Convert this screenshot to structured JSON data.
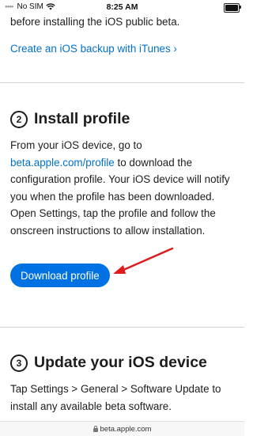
{
  "status_bar": {
    "carrier": "No SIM",
    "time": "8:25 AM"
  },
  "previous_section": {
    "text": "before installing the iOS public beta.",
    "backup_link": "Create an iOS backup with iTunes ›"
  },
  "step2": {
    "number": "2",
    "title": "Install profile",
    "text_before_link": "From your iOS device, go to ",
    "link": "beta.apple.com/profile",
    "text_after_link": " to download the configuration profile. Your iOS device will notify you when the profile has been downloaded. Open Settings, tap the profile and follow the onscreen instructions to allow installation.",
    "button_label": "Download profile"
  },
  "step3": {
    "number": "3",
    "title": "Update your iOS device",
    "text": "Tap Settings > General > Software Update to install any available beta software."
  },
  "url_bar": {
    "url": "beta.apple.com"
  },
  "colors": {
    "accent": "#0071e3",
    "link": "#0070c9",
    "annotation_arrow": "#e01b1b"
  }
}
